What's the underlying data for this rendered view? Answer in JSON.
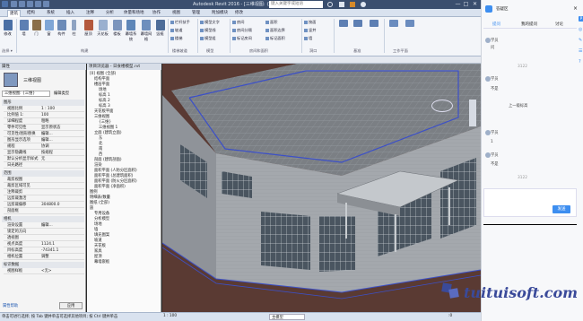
{
  "titlebar": {
    "title": "Autodesk Revit 2016 - [三维视图: {三维}]",
    "search_placeholder": "键入关键字或短语",
    "buttons": [
      "—",
      "□",
      "✕"
    ]
  },
  "tabs": [
    "建筑",
    "结构",
    "系统",
    "插入",
    "注释",
    "分析",
    "体量和场地",
    "协作",
    "视图",
    "管理",
    "附加模块",
    "修改"
  ],
  "ribbon": {
    "buttons": [
      "修改",
      "墙",
      "门",
      "窗",
      "构件",
      "柱",
      "屋顶",
      "天花板",
      "楼板",
      "幕墙系统",
      "幕墙网格",
      "竖梃"
    ],
    "small_col1": [
      "栏杆扶手",
      "坡道",
      "楼梯"
    ],
    "small_col2": [
      "模型文字",
      "模型线",
      "模型组"
    ],
    "small_col3": [
      "房间",
      "房间分隔",
      "标记房间"
    ],
    "small_col4": [
      "面积",
      "面积边界",
      "标记面积"
    ],
    "small_col5": [
      "按面",
      "竖井",
      "墙"
    ],
    "panels": [
      "选择",
      "构建",
      "楼梯坡道",
      "模型",
      "房间和面积",
      "洞口",
      "基准",
      "工作平面"
    ],
    "select_label": "选择 ▾"
  },
  "properties": {
    "header": "属性",
    "type_name": "三维视图",
    "type_selector": "三维视图: {三维}",
    "edit_type": "编辑类型",
    "sections": {
      "graphics": "图形",
      "range": "范围",
      "camera": "相机",
      "identity": "标识数据"
    },
    "rows_graphics": [
      {
        "k": "视图比例",
        "v": "1 : 100"
      },
      {
        "k": "比例值 1:",
        "v": "100"
      },
      {
        "k": "详细程度",
        "v": "粗略"
      },
      {
        "k": "零件可见性",
        "v": "显示原状态"
      },
      {
        "k": "可见性/图形替换",
        "v": "编辑..."
      },
      {
        "k": "图形显示选项",
        "v": "编辑..."
      },
      {
        "k": "规程",
        "v": "协调"
      },
      {
        "k": "显示隐藏线",
        "v": "按规程"
      },
      {
        "k": "默认分析显示样式",
        "v": "无"
      },
      {
        "k": "日光路径",
        "v": ""
      }
    ],
    "rows_range": [
      {
        "k": "裁剪视图",
        "v": ""
      },
      {
        "k": "裁剪区域可见",
        "v": ""
      },
      {
        "k": "注释裁剪",
        "v": ""
      },
      {
        "k": "远剪裁激活",
        "v": ""
      },
      {
        "k": "远剪裁偏移",
        "v": "304800.0"
      },
      {
        "k": "剖面框",
        "v": ""
      }
    ],
    "rows_camera": [
      {
        "k": "渲染设置",
        "v": "编辑..."
      },
      {
        "k": "锁定的方向",
        "v": ""
      },
      {
        "k": "透视图",
        "v": ""
      },
      {
        "k": "视点高度",
        "v": "1124.1"
      },
      {
        "k": "目标高度",
        "v": "-74341.1"
      },
      {
        "k": "相机位置",
        "v": "调整"
      }
    ],
    "rows_identity": [
      {
        "k": "视图样板",
        "v": "<无>"
      }
    ],
    "help_link": "属性帮助",
    "apply": "应用"
  },
  "browser": {
    "header": "项目浏览器 - 日食楼模型.rvt",
    "items": [
      {
        "t": "[0] 视图 (全部)",
        "d": 0
      },
      {
        "t": "结构平面",
        "d": 1
      },
      {
        "t": "楼层平面",
        "d": 1
      },
      {
        "t": "场地",
        "d": 2
      },
      {
        "t": "标高 1",
        "d": 2
      },
      {
        "t": "标高 2",
        "d": 2
      },
      {
        "t": "标高 3",
        "d": 2
      },
      {
        "t": "天花板平面",
        "d": 1
      },
      {
        "t": "三维视图",
        "d": 1
      },
      {
        "t": "{三维}",
        "d": 2
      },
      {
        "t": "三维视图 1",
        "d": 2
      },
      {
        "t": "立面 (建筑立面)",
        "d": 1
      },
      {
        "t": "东",
        "d": 2
      },
      {
        "t": "北",
        "d": 2
      },
      {
        "t": "南",
        "d": 2
      },
      {
        "t": "西",
        "d": 2
      },
      {
        "t": "剖面 (建筑剖面)",
        "d": 1
      },
      {
        "t": "渲染",
        "d": 1
      },
      {
        "t": "面积平面 (人防分区面积)",
        "d": 1
      },
      {
        "t": "面积平面 (总建筑面积)",
        "d": 1
      },
      {
        "t": "面积平面 (防火分区面积)",
        "d": 1
      },
      {
        "t": "面积平面 (净面积)",
        "d": 1
      },
      {
        "t": "图例",
        "d": 0
      },
      {
        "t": "明细表/数量",
        "d": 0
      },
      {
        "t": "图纸 (全部)",
        "d": 0
      },
      {
        "t": "族",
        "d": 0
      },
      {
        "t": "专用设备",
        "d": 1
      },
      {
        "t": "分析模型",
        "d": 1
      },
      {
        "t": "场地",
        "d": 1
      },
      {
        "t": "墙",
        "d": 1
      },
      {
        "t": "填充图案",
        "d": 1
      },
      {
        "t": "坡道",
        "d": 1
      },
      {
        "t": "天花板",
        "d": 1
      },
      {
        "t": "家具",
        "d": 1
      },
      {
        "t": "屋顶",
        "d": 1
      },
      {
        "t": "幕墙嵌板",
        "d": 1
      }
    ]
  },
  "statusbar": {
    "left": "单击可进行选择; 按 Tab 键并单击可选择其他项目; 按 Ctrl 键并单击",
    "scale": "1 : 100",
    "model": "主模型",
    "zoom": ":0"
  },
  "chat": {
    "title": "答疑区",
    "tabs": [
      "提问",
      "我的提问",
      "讨论"
    ],
    "messages": [
      {
        "who": "学员",
        "text": "问"
      },
      {
        "who": "",
        "text": "3122"
      },
      {
        "who": "学员",
        "text": "不是"
      },
      {
        "who": "",
        "text": "不是"
      },
      {
        "who": "",
        "text": "上一级标高"
      },
      {
        "who": "学员",
        "text": "1"
      },
      {
        "who": "学员",
        "text": "不是"
      },
      {
        "who": "",
        "text": "3122"
      }
    ],
    "send": "发送",
    "right_icons": [
      "P",
      "◎",
      "✎",
      "☰",
      "?"
    ]
  },
  "watermark": "tuituisoft.com",
  "colors": {
    "ribbon_bg": "#f3f5f9",
    "title_bg": "#3a4e6e",
    "view_bg": "#5a3a33",
    "send_btn": "#3d8ef0",
    "watermark": "#3a4a9a"
  }
}
